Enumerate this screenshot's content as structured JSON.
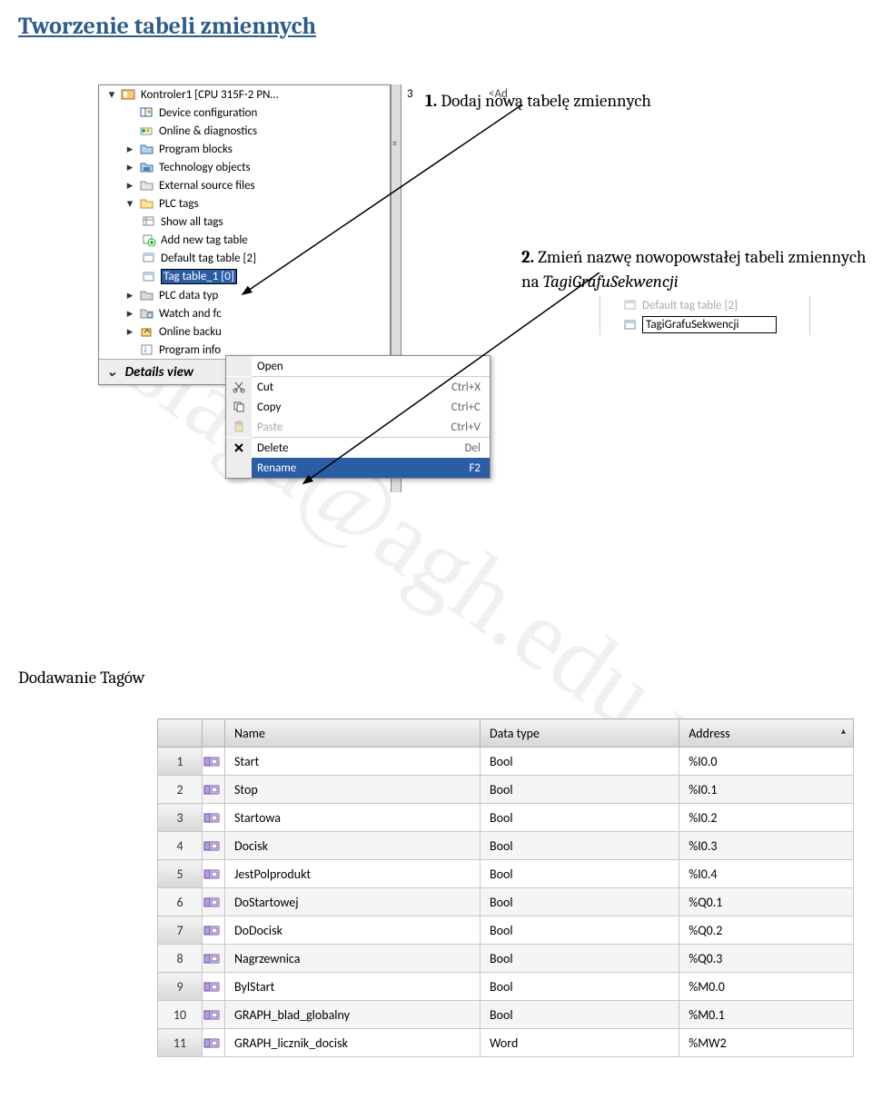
{
  "title": "Tworzenie tabeli zmiennych",
  "step1": {
    "num": "1.",
    "text": " Dodaj nową tabelę zmiennych"
  },
  "step2": {
    "num": "2.",
    "text": " Zmień nazwę nowopowstałej tabeli zmiennych na ",
    "italic": "TagiGrafuSekwencji"
  },
  "tree": {
    "root": "Kontroler1 [CPU 315F-2 PN…",
    "items": [
      "Device configuration",
      "Online & diagnostics",
      "Program blocks",
      "Technology objects",
      "External source files",
      "PLC tags"
    ],
    "plc_sub": [
      "Show all tags",
      "Add new tag table",
      "Default tag table [2]"
    ],
    "selected": "Tag table_1 [0]",
    "after_sel": [
      "PLC data typ",
      "Watch and fc",
      "Online backu",
      "Program info"
    ],
    "details": "Details view"
  },
  "panel_right": {
    "num": "3",
    "ad": "<Ad"
  },
  "ctx": [
    {
      "label": "Open",
      "sc": "",
      "enabled": true,
      "icon": ""
    },
    {
      "sep": true
    },
    {
      "label": "Cut",
      "sc": "Ctrl+X",
      "enabled": true,
      "icon": "cut"
    },
    {
      "label": "Copy",
      "sc": "Ctrl+C",
      "enabled": true,
      "icon": "copy"
    },
    {
      "label": "Paste",
      "sc": "Ctrl+V",
      "enabled": false,
      "icon": "paste"
    },
    {
      "sep": true
    },
    {
      "label": "Delete",
      "sc": "Del",
      "enabled": true,
      "icon": "delete"
    },
    {
      "label": "Rename",
      "sc": "F2",
      "enabled": true,
      "highlight": true,
      "icon": ""
    }
  ],
  "snippet": {
    "line_above": "Default tag table [2]",
    "editing": "TagiGrafuSekwencji"
  },
  "subhead": "Dodawanie Tagów",
  "table": {
    "headers": {
      "empty1": "",
      "empty2": "",
      "name": "Name",
      "type": "Data type",
      "addr": "Address"
    },
    "rows": [
      {
        "n": "1",
        "name": "Start",
        "type": "Bool",
        "addr": "%I0.0"
      },
      {
        "n": "2",
        "name": "Stop",
        "type": "Bool",
        "addr": "%I0.1"
      },
      {
        "n": "3",
        "name": "Startowa",
        "type": "Bool",
        "addr": "%I0.2"
      },
      {
        "n": "4",
        "name": "Docisk",
        "type": "Bool",
        "addr": "%I0.3"
      },
      {
        "n": "5",
        "name": "JestPolprodukt",
        "type": "Bool",
        "addr": "%I0.4"
      },
      {
        "n": "6",
        "name": "DoStartowej",
        "type": "Bool",
        "addr": "%Q0.1"
      },
      {
        "n": "7",
        "name": "DoDocisk",
        "type": "Bool",
        "addr": "%Q0.2"
      },
      {
        "n": "8",
        "name": "Nagrzewnica",
        "type": "Bool",
        "addr": "%Q0.3"
      },
      {
        "n": "9",
        "name": "BylStart",
        "type": "Bool",
        "addr": "%M0.0"
      },
      {
        "n": "10",
        "name": "GRAPH_blad_globalny",
        "type": "Bool",
        "addr": "%M0.1"
      },
      {
        "n": "11",
        "name": "GRAPH_licznik_docisk",
        "type": "Word",
        "addr": "%MW2"
      }
    ]
  },
  "watermark": "slaga@agh.edu.pl"
}
